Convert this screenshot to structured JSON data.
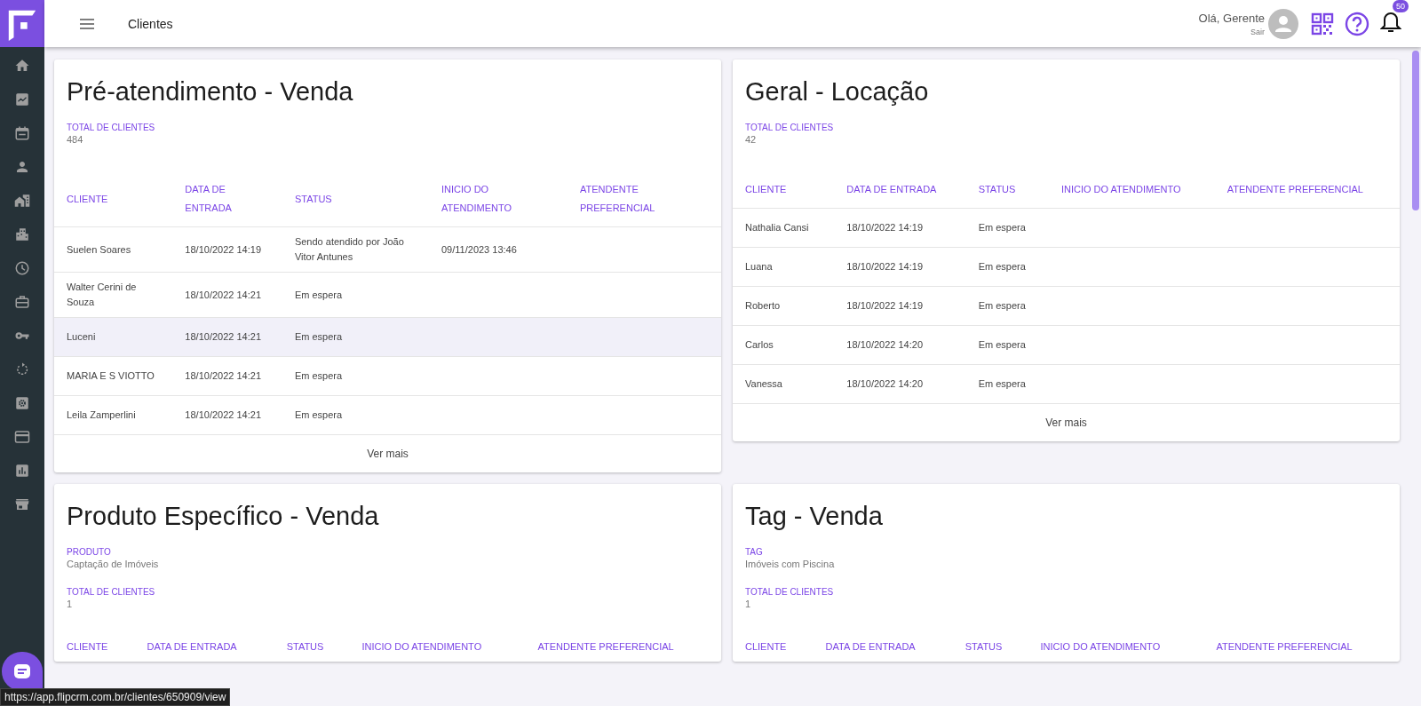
{
  "topbar": {
    "title": "Clientes",
    "greeting": "Olá, Gerente",
    "logout": "Sair",
    "notifications": "50"
  },
  "cards": [
    {
      "title": "Pré-atendimento - Venda",
      "fields": [
        {
          "label": "TOTAL DE CLIENTES",
          "value": "484"
        }
      ],
      "columns": [
        "CLIENTE",
        "DATA DE ENTRADA",
        "STATUS",
        "INICIO DO ATENDIMENTO",
        "ATENDENTE PREFERENCIAL"
      ],
      "rows": [
        {
          "highlighted": false,
          "cells": [
            "Suelen Soares",
            "18/10/2022 14:19",
            "Sendo atendido por João Vitor Antunes",
            "09/11/2023 13:46",
            ""
          ]
        },
        {
          "highlighted": false,
          "cells": [
            "Walter Cerini de Souza",
            "18/10/2022 14:21",
            "Em espera",
            "",
            ""
          ]
        },
        {
          "highlighted": true,
          "cells": [
            "Luceni",
            "18/10/2022 14:21",
            "Em espera",
            "",
            ""
          ]
        },
        {
          "highlighted": false,
          "cells": [
            "MARIA E S VIOTTO",
            "18/10/2022 14:21",
            "Em espera",
            "",
            ""
          ]
        },
        {
          "highlighted": false,
          "cells": [
            "Leila Zamperlini",
            "18/10/2022 14:21",
            "Em espera",
            "",
            ""
          ]
        }
      ],
      "more": "Ver mais"
    },
    {
      "title": "Geral - Locação",
      "fields": [
        {
          "label": "TOTAL DE CLIENTES",
          "value": "42"
        }
      ],
      "columns": [
        "CLIENTE",
        "DATA DE ENTRADA",
        "STATUS",
        "INICIO DO ATENDIMENTO",
        "ATENDENTE PREFERENCIAL"
      ],
      "rows": [
        {
          "highlighted": false,
          "cells": [
            "Nathalia Cansi",
            "18/10/2022 14:19",
            "Em espera",
            "",
            ""
          ]
        },
        {
          "highlighted": false,
          "cells": [
            "Luana",
            "18/10/2022 14:19",
            "Em espera",
            "",
            ""
          ]
        },
        {
          "highlighted": false,
          "cells": [
            "Roberto",
            "18/10/2022 14:19",
            "Em espera",
            "",
            ""
          ]
        },
        {
          "highlighted": false,
          "cells": [
            "Carlos",
            "18/10/2022 14:20",
            "Em espera",
            "",
            ""
          ]
        },
        {
          "highlighted": false,
          "cells": [
            "Vanessa",
            "18/10/2022 14:20",
            "Em espera",
            "",
            ""
          ]
        }
      ],
      "more": "Ver mais"
    },
    {
      "title": "Produto Específico - Venda",
      "fields": [
        {
          "label": "PRODUTO",
          "value": "Captação de Imóveis"
        },
        {
          "label": "TOTAL DE CLIENTES",
          "value": "1"
        }
      ],
      "columns": [
        "CLIENTE",
        "DATA DE ENTRADA",
        "STATUS",
        "INICIO DO ATENDIMENTO",
        "ATENDENTE PREFERENCIAL"
      ]
    },
    {
      "title": "Tag - Venda",
      "fields": [
        {
          "label": "TAG",
          "value": "Imóveis com Piscina"
        },
        {
          "label": "TOTAL DE CLIENTES",
          "value": "1"
        }
      ],
      "columns": [
        "CLIENTE",
        "DATA DE ENTRADA",
        "STATUS",
        "INICIO DO ATENDIMENTO",
        "ATENDENTE PREFERENCIAL"
      ]
    }
  ],
  "status_url": "https://app.flipcrm.com.br/clientes/650909/view"
}
